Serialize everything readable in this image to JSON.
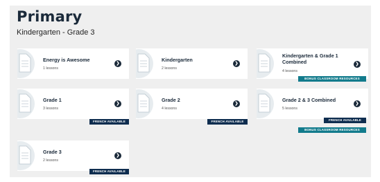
{
  "header": {
    "title": "Primary",
    "subtitle": "Kindergarten - Grade 3"
  },
  "cards": [
    {
      "name": "Energy is Awesome",
      "lessons": "1 lessons"
    },
    {
      "name": "Kindergarten",
      "lessons": "2 lessons"
    },
    {
      "name": "Kindergarten & Grade 1 Combined",
      "lessons": "4 lessons",
      "badge": "BONUS CLASSROOM RESOURCES"
    },
    {
      "name": "Grade 1",
      "lessons": "3 lessons",
      "badge": "FRENCH AVAILABLE"
    },
    {
      "name": "Grade 2",
      "lessons": "4 lessons",
      "badge": "FRENCH AVAILABLE"
    },
    {
      "name": "Grade 2 & 3 Combined",
      "lessons": "5 lessons",
      "badge": "FRENCH AVAILABLE",
      "badge2": "BONUS CLASSROOM RESOURCES"
    },
    {
      "name": "Grade 3",
      "lessons": "2 lessons",
      "badge": "FRENCH AVAILABLE"
    }
  ],
  "icons": {
    "card_doc": "document-icon",
    "card_arrow": "arrow-circle-icon"
  },
  "colors": {
    "navy": "#0e2d4f",
    "teal": "#127b8c",
    "panel_bg": "#efefef"
  }
}
